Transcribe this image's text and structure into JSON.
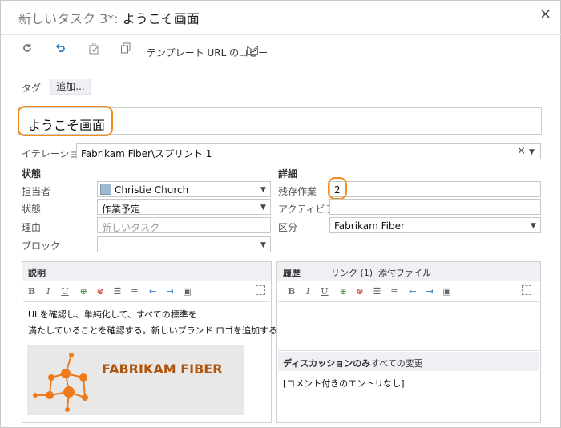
{
  "window": {
    "title_prefix": "新しいタスク 3*:",
    "title_name": "ようこそ画面",
    "close_glyph": "×"
  },
  "toolbar": {
    "copy_template_url": "テンプレート URL のコピー"
  },
  "tags": {
    "label": "タグ",
    "add_button": "追加..."
  },
  "work_item": {
    "title": "ようこそ画面"
  },
  "iteration": {
    "label": "イテレーション",
    "value": "Fabrikam Fiber\\スプリント 1"
  },
  "status": {
    "header": "状態",
    "assigned_to": {
      "label": "担当者",
      "value": "Christie Church"
    },
    "state": {
      "label": "状態",
      "value": "作業予定"
    },
    "reason": {
      "label": "理由",
      "placeholder": "新しいタスク"
    },
    "blocked": {
      "label": "ブロック",
      "value": ""
    }
  },
  "details": {
    "header": "詳細",
    "remaining_work": {
      "label": "残存作業",
      "value": "2"
    },
    "activity": {
      "label": "アクティビティ",
      "value": ""
    },
    "area": {
      "label": "区分",
      "value": "Fabrikam Fiber"
    }
  },
  "description": {
    "header": "説明",
    "text_line1": "UI を確認し、単純化して、すべての標準を",
    "text_line2": "満たしていることを確認する。新しいブランド ロゴを追加する。",
    "logo_text": "FABRIKAM FIBER"
  },
  "history": {
    "tabs": [
      "履歴",
      "リンク (1)",
      "添付ファイル"
    ],
    "filter_tabs": [
      "ディスカッションのみ",
      "すべての変更"
    ],
    "empty_text": "[コメント付きのエントリなし]"
  },
  "colors": {
    "accent_highlight": "#f28c1e",
    "logo_orange": "#f07a1a",
    "logo_text": "#b0550b",
    "panel_header": "#eef0f3"
  }
}
